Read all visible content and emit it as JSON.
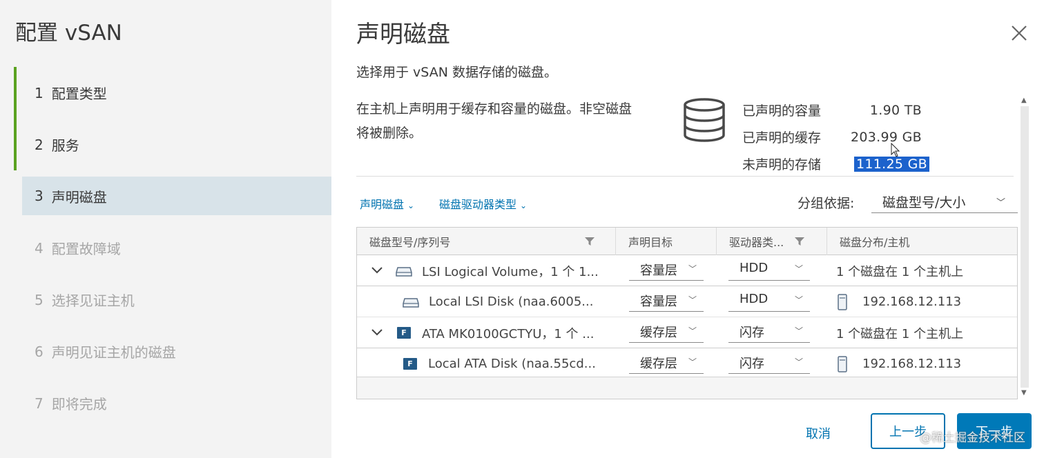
{
  "wizard": {
    "title": "配置 vSAN",
    "steps": [
      {
        "num": "1",
        "label": "配置类型"
      },
      {
        "num": "2",
        "label": "服务"
      },
      {
        "num": "3",
        "label": "声明磁盘"
      },
      {
        "num": "4",
        "label": "配置故障域"
      },
      {
        "num": "5",
        "label": "选择见证主机"
      },
      {
        "num": "6",
        "label": "声明见证主机的磁盘"
      },
      {
        "num": "7",
        "label": "即将完成"
      }
    ]
  },
  "page": {
    "title": "声明磁盘",
    "subtitle": "选择用于 vSAN 数据存储的磁盘。",
    "description": "在主机上声明用于缓存和容量的磁盘。非空磁盘将被删除。"
  },
  "stats": {
    "claimed_capacity_label": "已声明的容量",
    "claimed_capacity_value": "1.90 TB",
    "claimed_cache_label": "已声明的缓存",
    "claimed_cache_value": "203.99 GB",
    "unclaimed_label": "未声明的存储",
    "unclaimed_value": "111.25 GB"
  },
  "toolbar": {
    "claim_disks": "声明磁盘",
    "drive_type": "磁盘驱动器类型",
    "group_by_label": "分组依据:",
    "group_by_value": "磁盘型号/大小"
  },
  "table": {
    "columns": [
      "磁盘型号/序列号",
      "声明目标",
      "驱动器类...",
      "磁盘分布/主机"
    ],
    "rows": [
      {
        "name": "LSI Logical Volume，1 个 1...",
        "target": "容量层",
        "drive": "HDD",
        "host": "1 个磁盘在 1 个主机上"
      },
      {
        "name": "Local LSI Disk (naa.6005...",
        "target": "容量层",
        "drive": "HDD",
        "host": "192.168.12.113"
      },
      {
        "name": "ATA MK0100GCTYU，1 个 ...",
        "target": "缓存层",
        "drive": "闪存",
        "host": "1 个磁盘在 1 个主机上"
      },
      {
        "name": "Local ATA Disk (naa.55cd...",
        "target": "缓存层",
        "drive": "闪存",
        "host": "192.168.12.113"
      }
    ],
    "flash_badge": "F"
  },
  "footer": {
    "cancel": "取消",
    "back": "上一步",
    "next": "下一步"
  },
  "watermark": "@稀土掘金技术社区",
  "colors": {
    "accent": "#0079b8",
    "done_bar": "#5aa220",
    "active_step_bg": "#d8e3e9",
    "selection": "#1c62cc"
  }
}
